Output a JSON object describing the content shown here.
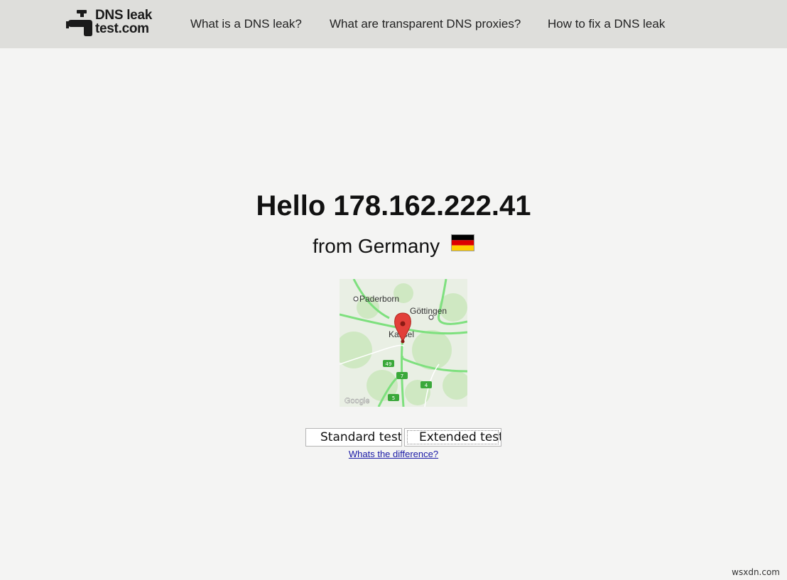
{
  "header": {
    "logo_line1": "DNS leak",
    "logo_line2": "test.com",
    "nav": [
      {
        "label": "What is a DNS leak?"
      },
      {
        "label": "What are transparent DNS proxies?"
      },
      {
        "label": "How to fix a DNS leak"
      }
    ]
  },
  "main": {
    "greeting": "Hello 178.162.222.41",
    "from_text": "from Germany",
    "flag_colors": [
      "#000000",
      "#dd0000",
      "#ffce00"
    ],
    "map": {
      "labels": [
        "Paderborn",
        "Göttingen",
        "Kassel"
      ],
      "road_shields": [
        "49",
        "7",
        "4",
        "5"
      ],
      "attribution": "Google"
    },
    "buttons": {
      "standard": "Standard test",
      "extended": "Extended test"
    },
    "difference_link": "Whats the difference?"
  },
  "watermark": "wsxdn.com"
}
